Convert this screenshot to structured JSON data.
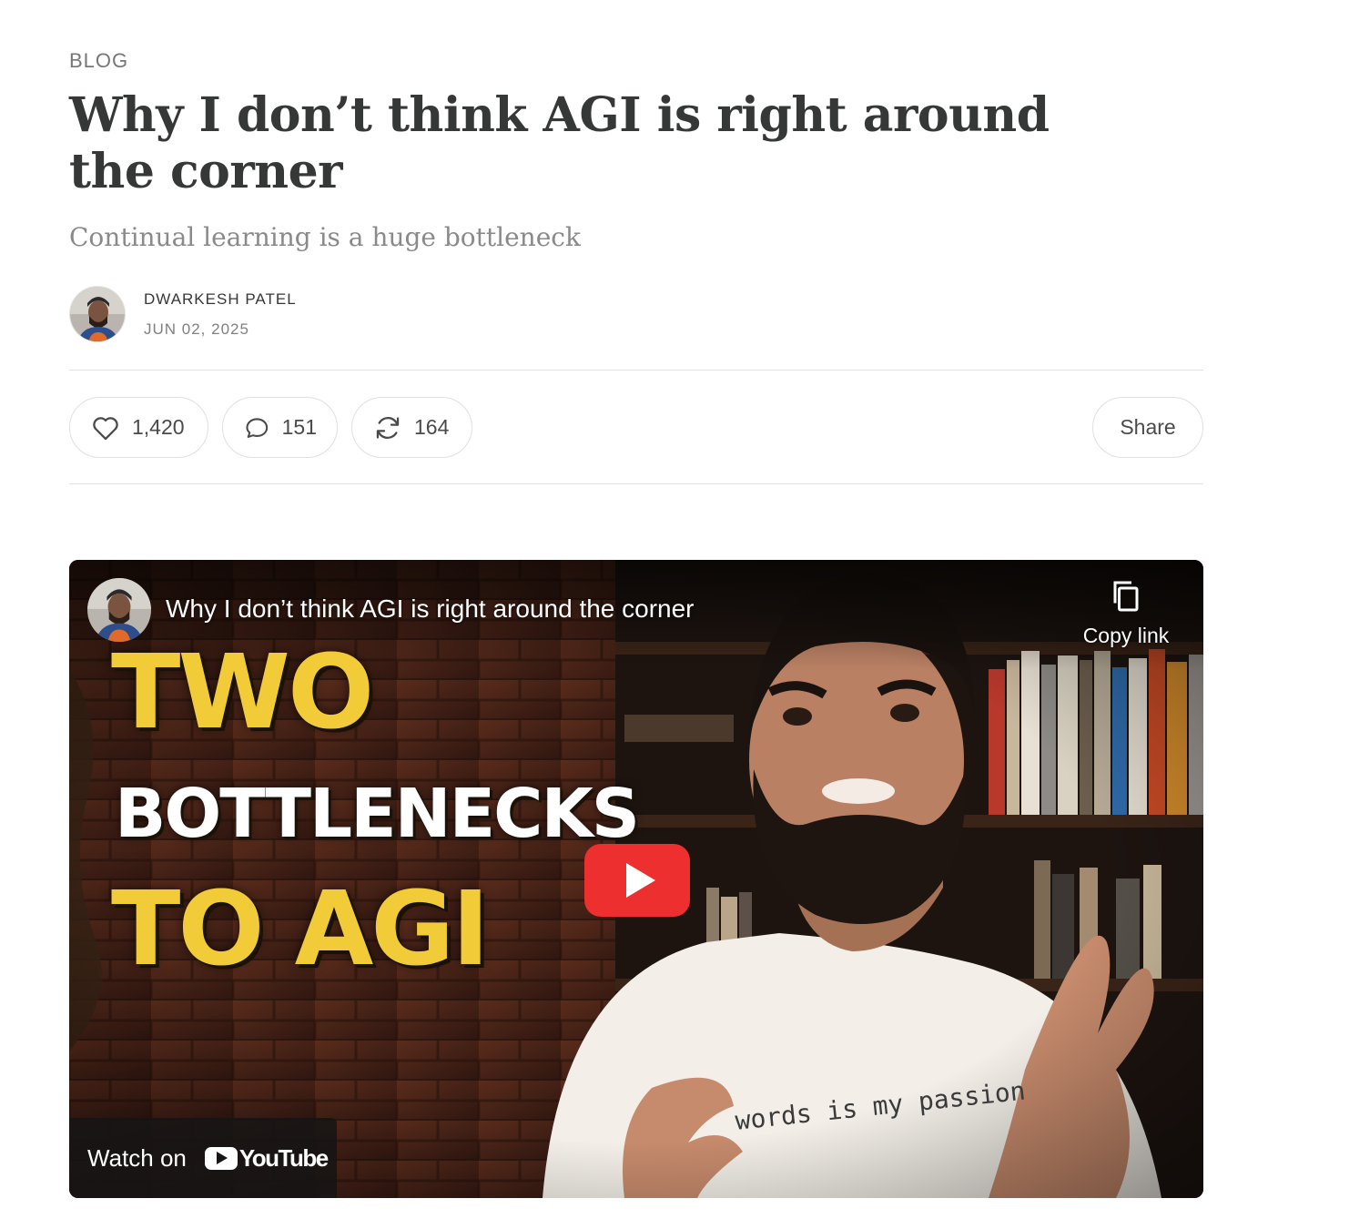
{
  "header": {
    "section": "BLOG",
    "title": "Why I don’t think AGI is right around the corner",
    "subtitle": "Continual learning is a huge bottleneck"
  },
  "byline": {
    "author": "DWARKESH PATEL",
    "date": "JUN 02, 2025"
  },
  "actions": {
    "likes": "1,420",
    "comments": "151",
    "restacks": "164",
    "share_label": "Share"
  },
  "video": {
    "title": "Why I don’t think AGI is right around the corner",
    "copy_link_label": "Copy link",
    "thumbnail_text": [
      "TWO",
      "BOTTLENECKS",
      "TO AGI"
    ],
    "shirt_text": "words is my passion",
    "watch_on_label": "Watch on",
    "platform_name": "YouTube",
    "accent_color": "#EE2F2F",
    "headline_color": "#F2CC38"
  }
}
